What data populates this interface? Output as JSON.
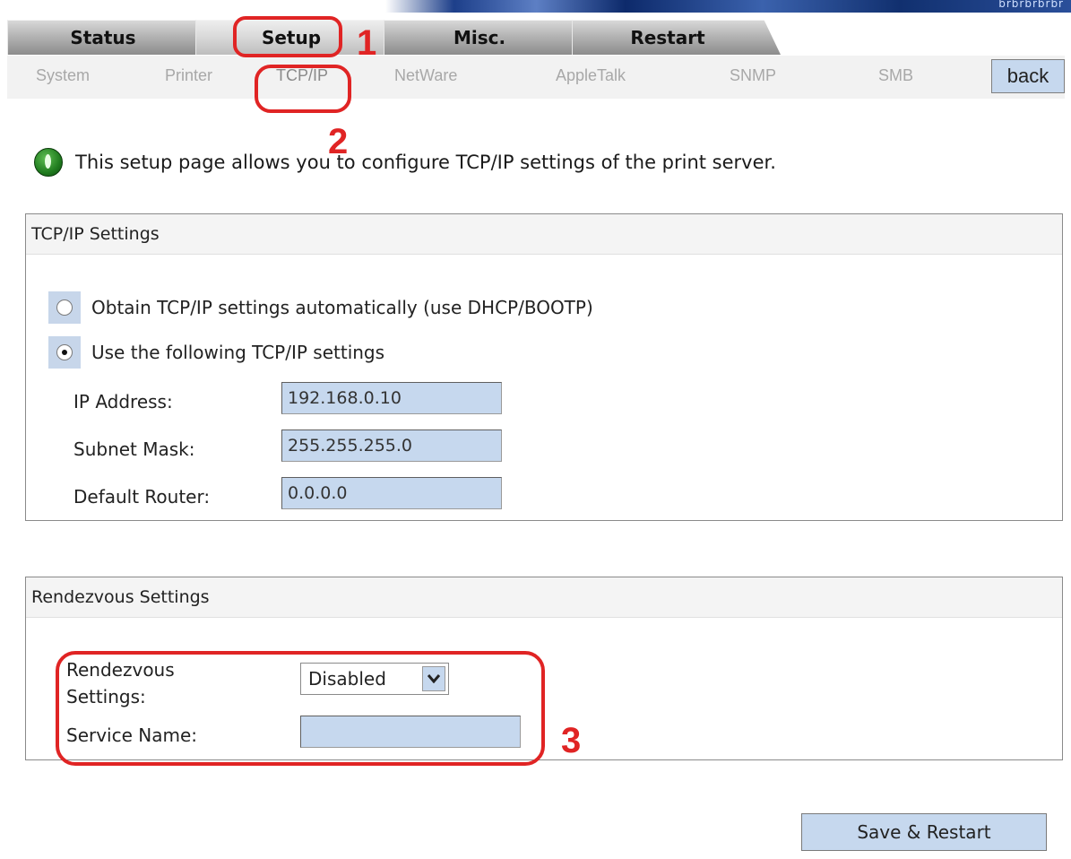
{
  "banner": {
    "text": "brbrbrbrbr"
  },
  "main_tabs": [
    {
      "label": "Status",
      "active": false
    },
    {
      "label": "Setup",
      "active": true
    },
    {
      "label": "Misc.",
      "active": false
    },
    {
      "label": "Restart",
      "active": false
    }
  ],
  "sub_tabs": [
    {
      "label": "System"
    },
    {
      "label": "Printer"
    },
    {
      "label": "TCP/IP",
      "active": true
    },
    {
      "label": "NetWare"
    },
    {
      "label": "AppleTalk"
    },
    {
      "label": "SNMP"
    },
    {
      "label": "SMB"
    }
  ],
  "back_label": "back",
  "intro": {
    "text": "This setup page allows you to configure TCP/IP settings of the print server."
  },
  "tcpip": {
    "title": "TCP/IP Settings",
    "option_auto": "Obtain TCP/IP settings automatically (use DHCP/BOOTP)",
    "option_manual": "Use the following TCP/IP settings",
    "selected_option": "manual",
    "ip_label": "IP Address:",
    "ip_value": "192.168.0.10",
    "subnet_label": "Subnet Mask:",
    "subnet_value": "255.255.255.0",
    "router_label": "Default Router:",
    "router_value": "0.0.0.0"
  },
  "rendezvous": {
    "title": "Rendezvous Settings",
    "settings_label_line1": "Rendezvous",
    "settings_label_line2": "Settings:",
    "settings_value": "Disabled",
    "service_label": "Service Name:",
    "service_value": ""
  },
  "save_label": "Save & Restart",
  "annotations": {
    "one": "1",
    "two": "2",
    "three": "3",
    "color": "#e02424"
  },
  "colors": {
    "field_bg": "#c6d8ee",
    "tab_gray": "#b4b4b4",
    "subtab_text": "#a8a8a8"
  }
}
